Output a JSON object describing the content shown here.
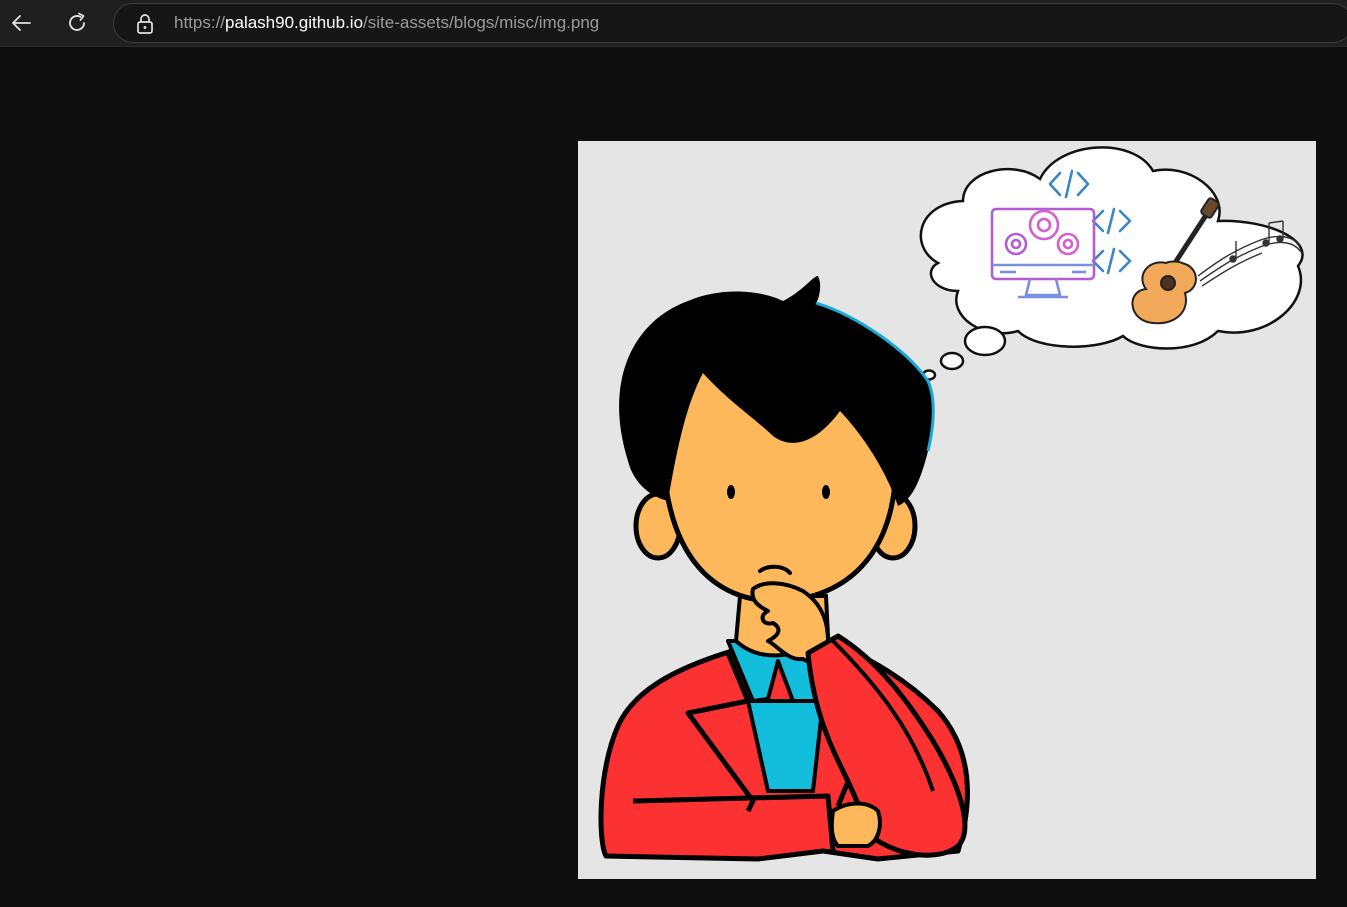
{
  "browser": {
    "back_button": "back-arrow-icon",
    "reload_button": "reload-icon",
    "address": {
      "security_icon": "lock-icon",
      "scheme": "https://",
      "host": "palash90.github.io",
      "path": "/site-assets/blogs/misc/img.png"
    }
  },
  "viewer": {
    "image_file": "img.png",
    "background_color": "#0e0e0e",
    "image_background_color": "#e5e5e5"
  },
  "illustration": {
    "subject": "thinking-person",
    "thought_cloud_items": [
      "code-tag-icon",
      "monitor-gears-icon",
      "guitar-icon",
      "music-notes-icon"
    ],
    "colors": {
      "skin": "#fcb85a",
      "hair": "#000000",
      "hair_highlight": "#19a9d6",
      "jacket": "#fc3131",
      "shirt": "#12bedc",
      "guitar": "#f3a95b",
      "code_icon": "#3d86c6"
    }
  }
}
